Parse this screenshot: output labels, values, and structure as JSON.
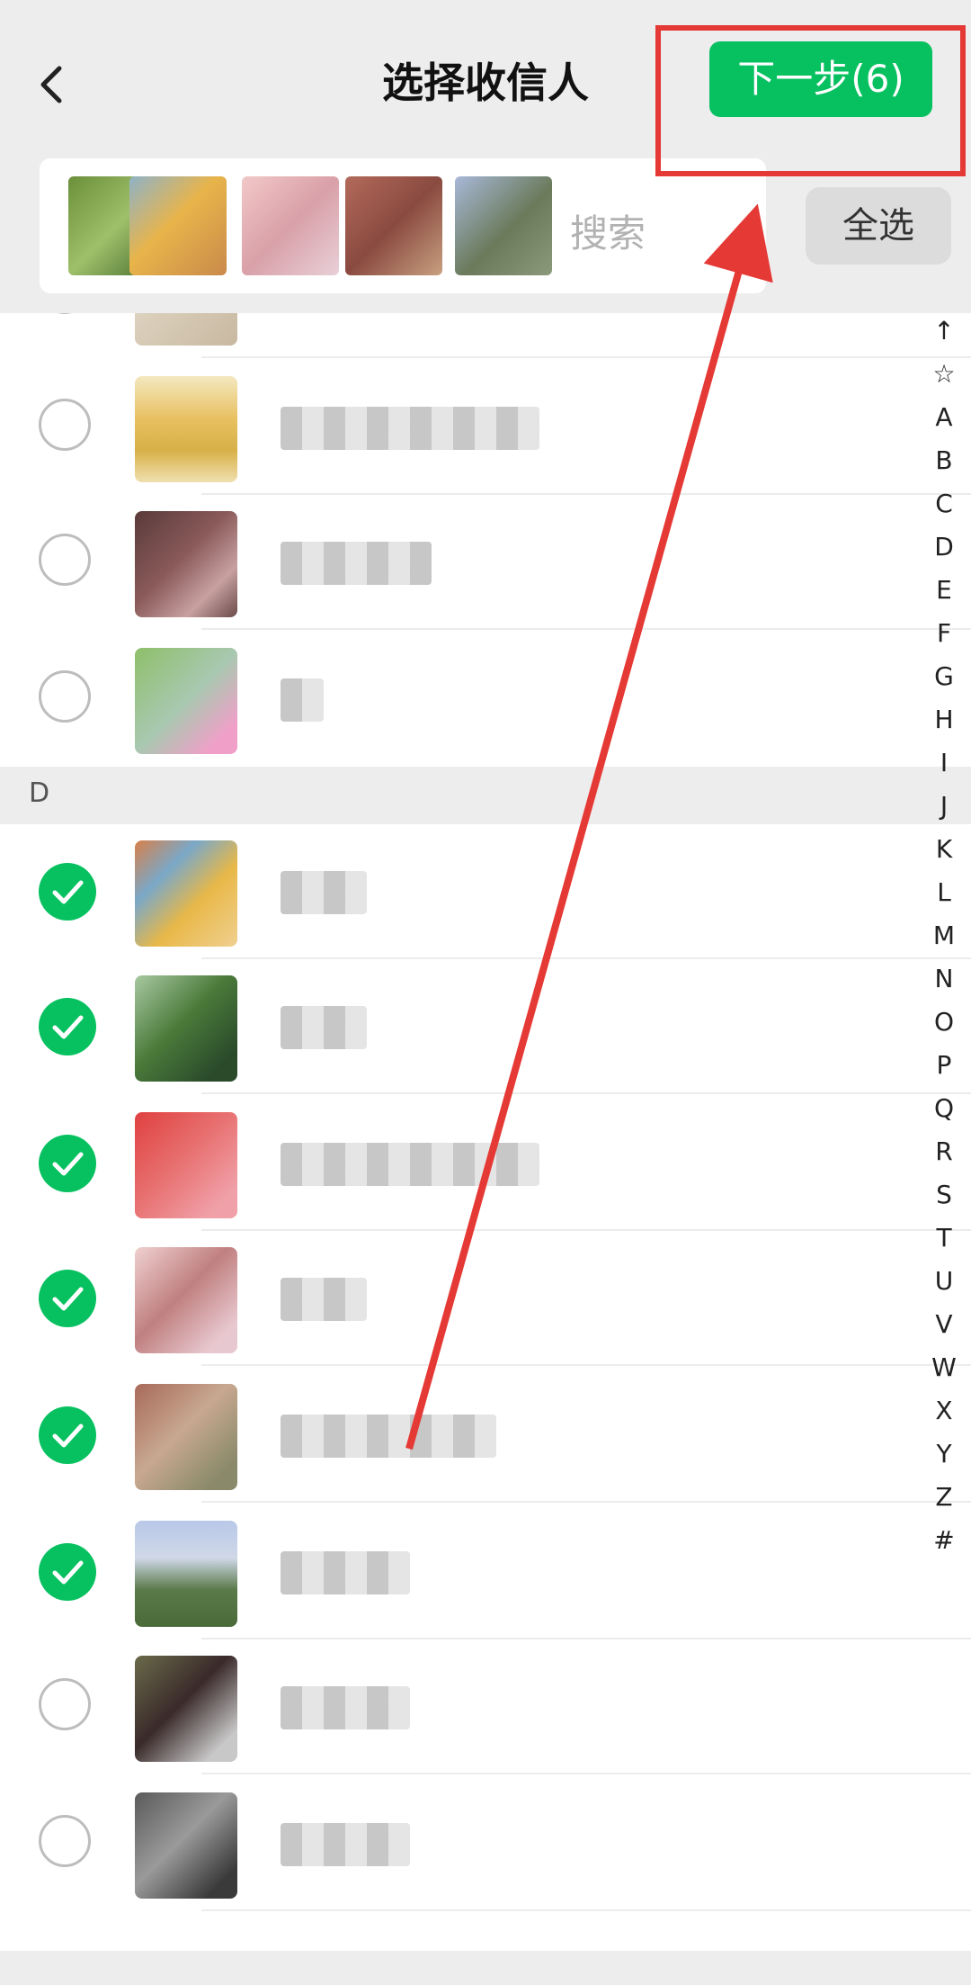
{
  "header": {
    "title": "选择收信人",
    "next_label": "下一步(6)"
  },
  "search": {
    "placeholder": "搜索",
    "select_all_label": "全选"
  },
  "section_header": "D",
  "index_letters": [
    "↑",
    "☆",
    "A",
    "B",
    "C",
    "D",
    "E",
    "F",
    "G",
    "H",
    "I",
    "J",
    "K",
    "L",
    "M",
    "N",
    "O",
    "P",
    "Q",
    "R",
    "S",
    "T",
    "U",
    "V",
    "W",
    "X",
    "Y",
    "Z",
    "#"
  ],
  "colors": {
    "accent_green": "#07c160",
    "annotation_red": "#e53935"
  },
  "selection_count": 6,
  "contacts_checked": [
    false,
    false,
    false,
    false,
    true,
    true,
    true,
    true,
    true,
    true,
    false,
    false
  ],
  "icons": {
    "back": "chevron-left-icon",
    "check": "checkmark-icon"
  }
}
